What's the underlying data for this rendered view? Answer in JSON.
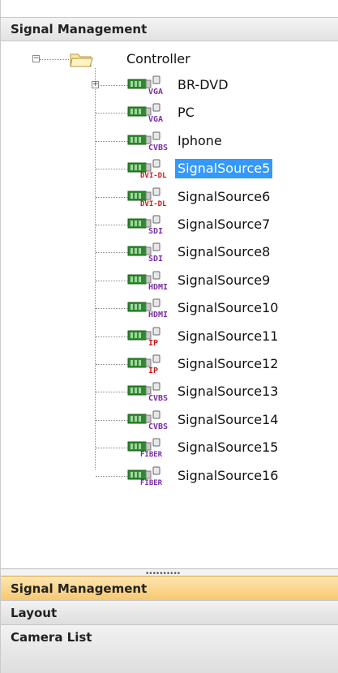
{
  "header": {
    "title": "Signal Management"
  },
  "tree": {
    "root_label": "Controller",
    "selected_index": 3,
    "items": [
      {
        "label": "BR-DVD",
        "type": "VGA",
        "expandable": true
      },
      {
        "label": "PC",
        "type": "VGA",
        "expandable": false
      },
      {
        "label": "Iphone",
        "type": "CVBS",
        "expandable": false
      },
      {
        "label": "SignalSource5",
        "type": "DVI-DL",
        "expandable": false
      },
      {
        "label": "SignalSource6",
        "type": "DVI-DL",
        "expandable": false
      },
      {
        "label": "SignalSource7",
        "type": "SDI",
        "expandable": false
      },
      {
        "label": "SignalSource8",
        "type": "SDI",
        "expandable": false
      },
      {
        "label": "SignalSource9",
        "type": "HDMI",
        "expandable": false
      },
      {
        "label": "SignalSource10",
        "type": "HDMI",
        "expandable": false
      },
      {
        "label": "SignalSource11",
        "type": "IP",
        "expandable": false
      },
      {
        "label": "SignalSource12",
        "type": "IP",
        "expandable": false
      },
      {
        "label": "SignalSource13",
        "type": "CVBS",
        "expandable": false
      },
      {
        "label": "SignalSource14",
        "type": "CVBS",
        "expandable": false
      },
      {
        "label": "SignalSource15",
        "type": "Fiber",
        "expandable": false
      },
      {
        "label": "SignalSource16",
        "type": "Fiber",
        "expandable": false
      }
    ]
  },
  "panels": [
    {
      "label": "Signal Management",
      "active": true
    },
    {
      "label": "Layout",
      "active": false
    },
    {
      "label": "Camera List",
      "active": false
    }
  ],
  "colors": {
    "selection": "#3399ff",
    "active_panel": "#f7c870"
  }
}
